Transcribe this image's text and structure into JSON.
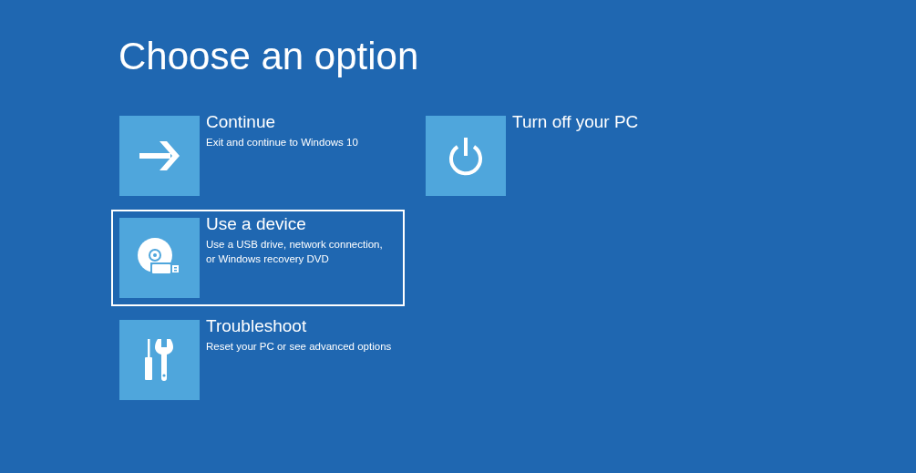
{
  "title": "Choose an option",
  "columns": [
    {
      "options": [
        {
          "kind": "continue",
          "label": "Continue",
          "description": "Exit and continue to Windows 10",
          "selected": false
        },
        {
          "kind": "device",
          "label": "Use a device",
          "description": "Use a USB drive, network connection, or Windows recovery DVD",
          "selected": true
        },
        {
          "kind": "troubleshoot",
          "label": "Troubleshoot",
          "description": "Reset your PC or see advanced options",
          "selected": false
        }
      ]
    },
    {
      "options": [
        {
          "kind": "power",
          "label": "Turn off your PC",
          "selected": false
        }
      ]
    }
  ]
}
